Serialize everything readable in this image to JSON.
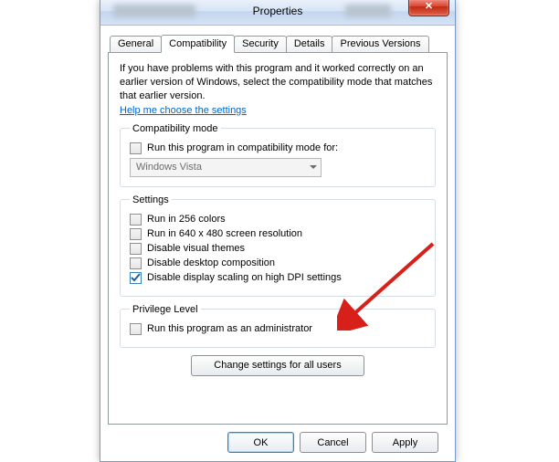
{
  "window": {
    "title": "Properties"
  },
  "tabs": {
    "general": "General",
    "compatibility": "Compatibility",
    "security": "Security",
    "details": "Details",
    "previous": "Previous Versions"
  },
  "intro_text": "If you have problems with this program and it worked correctly on an earlier version of Windows, select the compatibility mode that matches that earlier version.",
  "help_link": "Help me choose the settings",
  "compat_mode": {
    "legend": "Compatibility mode",
    "checkbox_label": "Run this program in compatibility mode for:",
    "combo_value": "Windows Vista"
  },
  "settings": {
    "legend": "Settings",
    "opt_256": "Run in 256 colors",
    "opt_640": "Run in 640 x 480 screen resolution",
    "opt_themes": "Disable visual themes",
    "opt_compo": "Disable desktop composition",
    "opt_dpi": "Disable display scaling on high DPI settings"
  },
  "privilege": {
    "legend": "Privilege Level",
    "opt_admin": "Run this program as an administrator"
  },
  "change_all": "Change settings for all users",
  "footer": {
    "ok": "OK",
    "cancel": "Cancel",
    "apply": "Apply"
  }
}
